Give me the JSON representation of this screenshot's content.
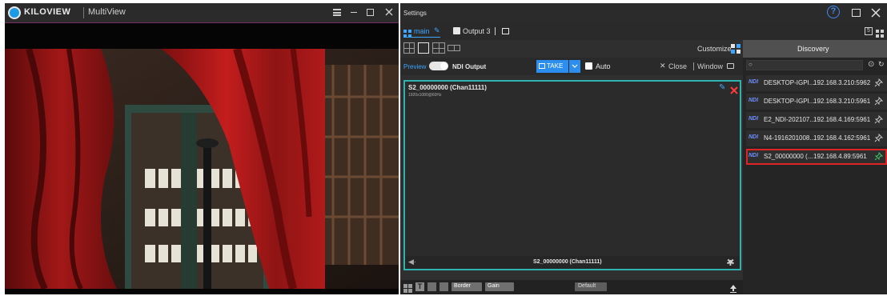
{
  "left_window": {
    "brand": "KILOVIEW",
    "app_title": "MultiView"
  },
  "right_window": {
    "title": "Settings",
    "tabs": [
      {
        "label": "main"
      },
      {
        "label": "Output 3"
      }
    ],
    "customize_label": "Customize",
    "toolbar": {
      "preview_label": "Preview",
      "ndi_output_label": "NDI Output",
      "take_label": "TAKE",
      "auto_label": "Auto",
      "close_label": "Close",
      "window_label": "Window"
    },
    "preview": {
      "source_name": "S2_00000000 (Chan11111)",
      "resolution": "1920x1080@60Hz",
      "footer_name": "S2_00000000 (Chan11111)"
    },
    "bottom": {
      "border_label": "Border",
      "gain_label": "Gain",
      "default_label": "Default"
    },
    "discovery": {
      "title": "Discovery",
      "search_placeholder": "",
      "badge": "NDI",
      "items": [
        {
          "name": "DESKTOP-IGPI...",
          "address": "192.168.3.210:5962",
          "selected": false
        },
        {
          "name": "DESKTOP-IGPI...",
          "address": "192.168.3.210:5961",
          "selected": false
        },
        {
          "name": "E2_NDI-202107...",
          "address": "192.168.4.169:5961",
          "selected": false
        },
        {
          "name": "N4-1916201008...",
          "address": "192.168.4.162:5961",
          "selected": false
        },
        {
          "name": "S2_00000000 (...",
          "address": "192.168.4.89:5961",
          "selected": true
        }
      ]
    },
    "colors": {
      "accent_blue": "#1e88e5",
      "preview_border": "#2fb3b0",
      "selected_outline": "#e02424",
      "ndi_blue": "#6d8fff"
    }
  }
}
